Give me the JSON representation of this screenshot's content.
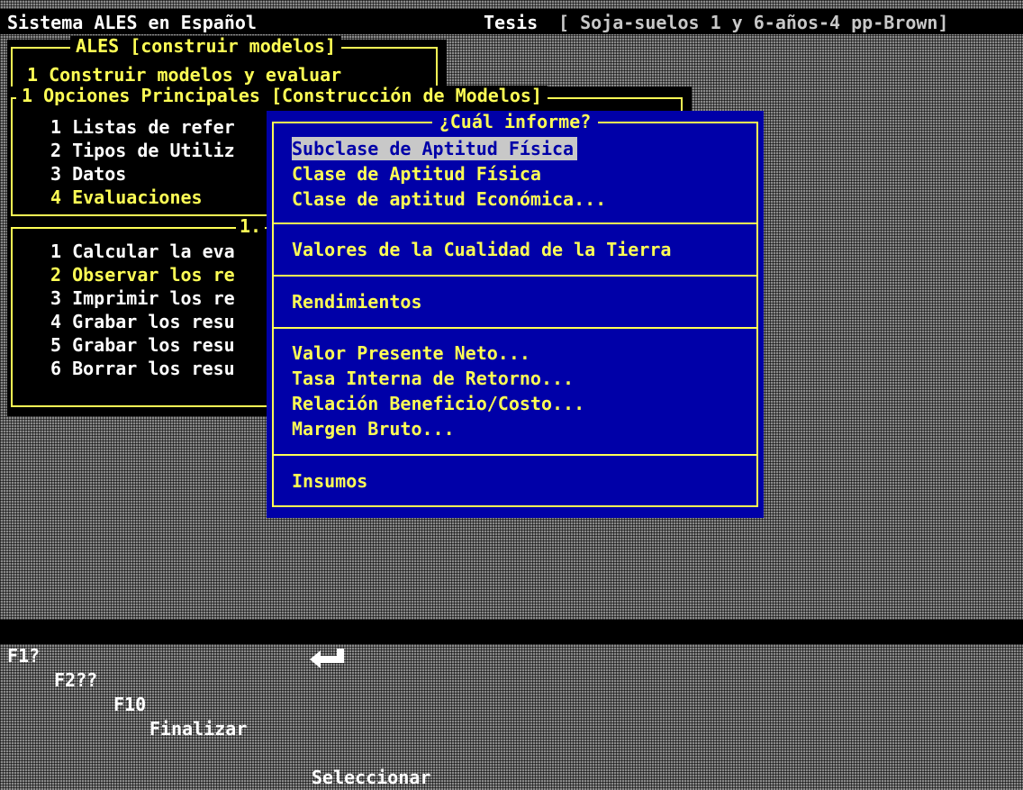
{
  "header": {
    "app_title": "Sistema ALES en Español",
    "thesis_label": "Tesis",
    "model_name": "[ Soja-suelos 1 y 6-años-4 pp-Brown]"
  },
  "ales_menu": {
    "title": "ALES [construir modelos]",
    "item": "1 Construir modelos y evaluar"
  },
  "options_menu": {
    "title": "1 Opciones Principales [Construcción de Modelos]",
    "items": [
      "1 Listas de refer",
      "2 Tipos de Utiliz",
      "3 Datos",
      "4 Evaluaciones"
    ]
  },
  "eval_menu": {
    "title": "1.",
    "items": [
      "1 Calcular la eva",
      "2 Observar los re",
      "3 Imprimir los re",
      "4 Grabar los resu",
      "5 Grabar los resu",
      "6 Borrar los resu"
    ]
  },
  "popup": {
    "title": "¿Cuál informe?",
    "groups": [
      [
        "Subclase de Aptitud Física",
        "Clase de Aptitud Física",
        "Clase de aptitud Económica..."
      ],
      [
        "Valores de la Cualidad de la Tierra"
      ],
      [
        "Rendimientos"
      ],
      [
        "Valor Presente Neto...",
        "Tasa Interna de Retorno...",
        "Relación Beneficio/Costo...",
        "Margen Bruto..."
      ],
      [
        "Insumos"
      ]
    ]
  },
  "statusbar": {
    "f1": "F1?",
    "f2": "F2??",
    "f10": "F10",
    "f10_label": "Finalizar",
    "enter_label": "Seleccionar"
  }
}
